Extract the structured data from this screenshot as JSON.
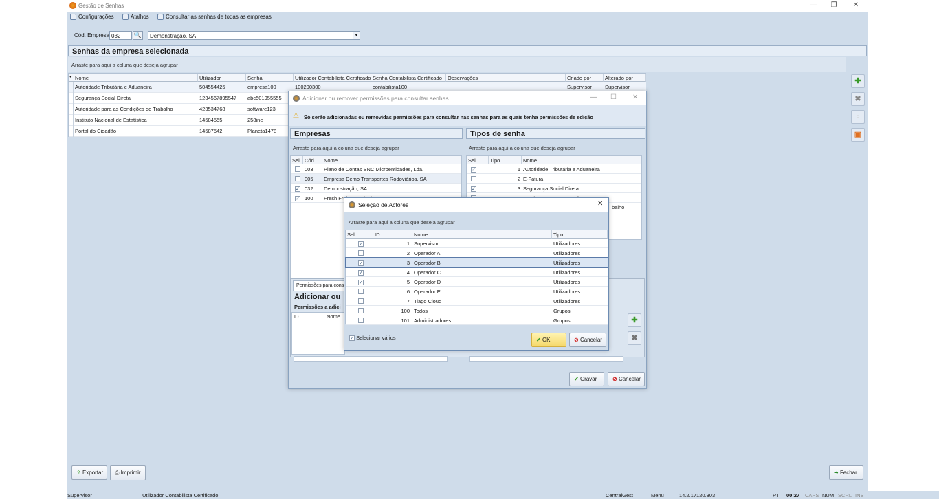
{
  "window": {
    "title": "Gestão de Senhas"
  },
  "menu": {
    "config": "Configurações",
    "shortcuts": "Atalhos",
    "all": "Consultar as senhas de todas as empresas"
  },
  "company": {
    "label": "Cód. Empresa:",
    "code": "032",
    "name": "Demonstração, SA"
  },
  "main": {
    "title": "Senhas da empresa selecionada",
    "group_hint": "Arraste para aqui a coluna que deseja agrupar",
    "columns": [
      "Nome",
      "Utilizador",
      "Senha",
      "Utilizador Contabilista Certificado",
      "Senha Contabilista Certificado",
      "Observações",
      "Criado por",
      "Alterado por"
    ],
    "rows": [
      {
        "nome": "Autoridade Tributária e Aduaneira",
        "util": "504554425",
        "senha": "empresa100",
        "ucc": "100200300",
        "scc": "contabilista100",
        "criado": "Supervisor",
        "alterado": "Supervisor"
      },
      {
        "nome": "Segurança Social Direta",
        "util": "1234567895547",
        "senha": "abc501955555"
      },
      {
        "nome": "Autoridade para as Condições do Trabalho",
        "util": "423534768",
        "senha": "software123"
      },
      {
        "nome": "Instituto Nacional de Estatística",
        "util": "14584555",
        "senha": "258ine"
      },
      {
        "nome": "Portal do Cidadão",
        "util": "14587542",
        "senha": "Planeta1478"
      }
    ]
  },
  "perm_dialog": {
    "title": "Adicionar ou remover permissões para consultar senhas",
    "warning": "Só serão adicionadas ou removidas permissões para consultar nas senhas para as quais tenha permissões de edição",
    "empresas": {
      "title": "Empresas",
      "hint": "Arraste para aqui a coluna que deseja agrupar",
      "cols": [
        "Sel.",
        "Cód.",
        "Nome"
      ],
      "rows": [
        {
          "sel": false,
          "cod": "003",
          "nome": "Plano de Contas SNC Microentidades, Lda."
        },
        {
          "sel": false,
          "cod": "005",
          "nome": "Empresa Demo Transportes Rodoviários, SA"
        },
        {
          "sel": true,
          "cod": "032",
          "nome": "Demonstração, SA"
        },
        {
          "sel": true,
          "cod": "100",
          "nome": "Fresh Fruit Tecnologia, SA"
        }
      ]
    },
    "tipos": {
      "title": "Tipos de senha",
      "hint": "Arraste para aqui a coluna que deseja agrupar",
      "cols": [
        "Sel.",
        "Tipo",
        "Nome"
      ],
      "rows": [
        {
          "sel": true,
          "tipo": "1",
          "nome": "Autoridade Tributária e Aduaneira"
        },
        {
          "sel": false,
          "tipo": "2",
          "nome": "E-Fatura"
        },
        {
          "sel": true,
          "tipo": "3",
          "nome": "Segurança Social Direta"
        },
        {
          "sel": false,
          "tipo": "4",
          "nome": "Fundos de Compensação"
        }
      ],
      "partial": "balho"
    },
    "tab_label": "Permissões para cons",
    "section_title": "Adicionar ou",
    "perm_sub": "Permissões a adici",
    "perm_cols": [
      "ID",
      "Nome"
    ],
    "save": "Gravar",
    "cancel": "Cancelar"
  },
  "actors_dialog": {
    "title": "Seleção de Actores",
    "hint": "Arraste para aqui a coluna que deseja agrupar",
    "cols": [
      "Sel.",
      "ID",
      "Nome",
      "Tipo"
    ],
    "rows": [
      {
        "sel": true,
        "id": "1",
        "nome": "Supervisor",
        "tipo": "Utilizadores"
      },
      {
        "sel": false,
        "id": "2",
        "nome": "Operador A",
        "tipo": "Utilizadores"
      },
      {
        "sel": true,
        "id": "3",
        "nome": "Operador B",
        "tipo": "Utilizadores"
      },
      {
        "sel": true,
        "id": "4",
        "nome": "Operador C",
        "tipo": "Utilizadores"
      },
      {
        "sel": true,
        "id": "5",
        "nome": "Operador D",
        "tipo": "Utilizadores"
      },
      {
        "sel": false,
        "id": "6",
        "nome": "Operador E",
        "tipo": "Utilizadores"
      },
      {
        "sel": false,
        "id": "7",
        "nome": "Tiago Cloud",
        "tipo": "Utilizadores"
      },
      {
        "sel": false,
        "id": "100",
        "nome": "Todos",
        "tipo": "Grupos"
      },
      {
        "sel": false,
        "id": "101",
        "nome": "Administradores",
        "tipo": "Grupos"
      }
    ],
    "select_many": "Selecionar vários",
    "ok": "OK",
    "cancel": "Cancelar"
  },
  "bottom": {
    "export": "Exportar",
    "print": "Imprimir",
    "close": "Fechar"
  },
  "status": {
    "user": "Supervisor",
    "role": "Utilizador Contabilista Certificado",
    "app": "CentralGest",
    "menu": "Menu",
    "version": "14.2.17120.303",
    "lang": "PT",
    "time": "00:27",
    "caps": "CAPS",
    "num": "NUM",
    "scrl": "SCRL",
    "ins": "INS"
  }
}
